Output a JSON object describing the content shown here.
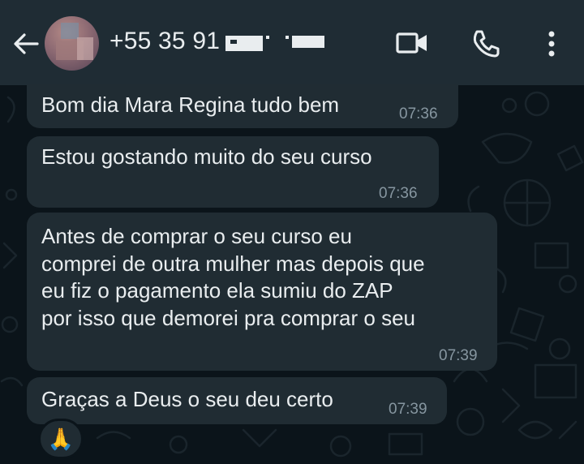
{
  "header": {
    "contact_name": "+55 35 91",
    "back_icon": "arrow-left-icon",
    "video_icon": "video-camera-icon",
    "call_icon": "phone-icon",
    "menu_icon": "more-vertical-icon"
  },
  "messages": [
    {
      "lines": [
        "Bom dia Mara Regina tudo bem"
      ],
      "time": "07:36"
    },
    {
      "lines": [
        "Estou gostando muito do seu curso"
      ],
      "time": "07:36"
    },
    {
      "lines": [
        "Antes de comprar o seu curso eu",
        "comprei de outra mulher mas depois que",
        "eu fiz o pagamento ela sumiu do ZAP",
        "por isso que demorei pra comprar o seu"
      ],
      "time": "07:39"
    },
    {
      "lines": [
        "Graças a Deus o seu deu certo"
      ],
      "time": "07:39"
    }
  ],
  "reaction": {
    "emoji": "🙏"
  },
  "colors": {
    "header_bg": "#1f2c34",
    "chat_bg": "#0b141a",
    "bubble_bg": "#202c33",
    "text": "#e9edef",
    "time": "#8696a0"
  }
}
